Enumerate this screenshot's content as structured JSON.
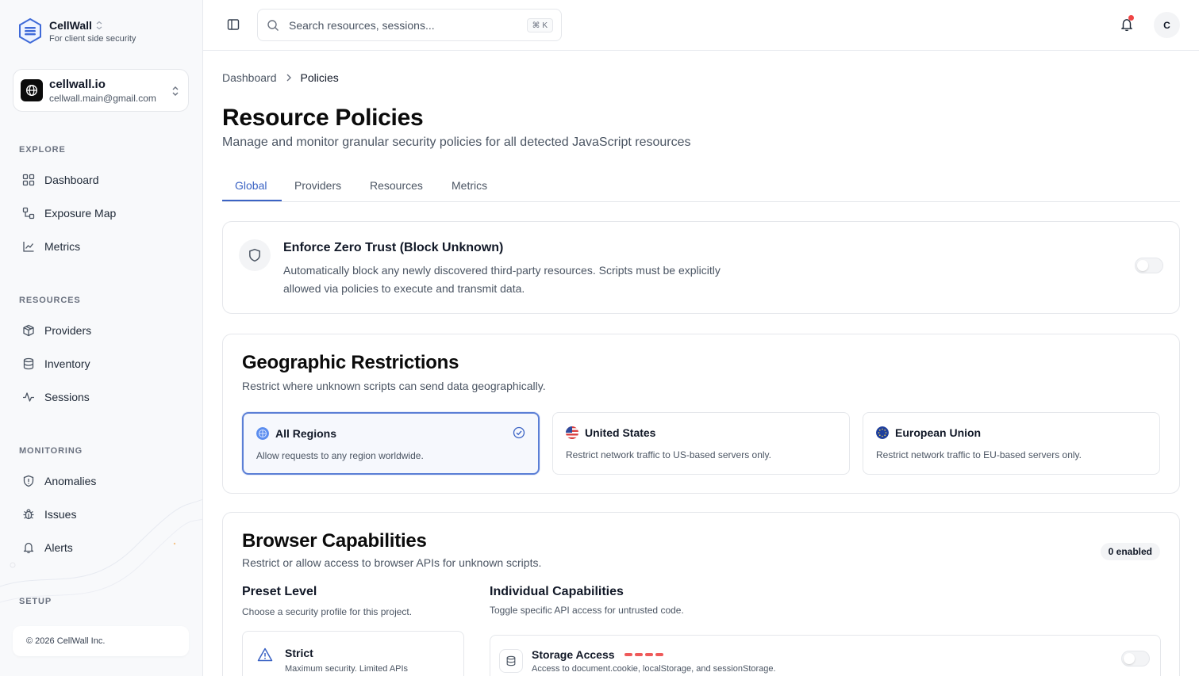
{
  "sidebar": {
    "brand_name": "CellWall",
    "brand_tagline": "For client side security",
    "site": {
      "name": "cellwall.io",
      "email": "cellwall.main@gmail.com"
    },
    "sections": {
      "explore": "EXPLORE",
      "resources": "RESOURCES",
      "monitoring": "MONITORING",
      "setup": "SETUP"
    },
    "items": [
      {
        "label": "Dashboard",
        "icon": "grid-icon"
      },
      {
        "label": "Exposure Map",
        "icon": "network-icon"
      },
      {
        "label": "Metrics",
        "icon": "line-chart-icon"
      },
      {
        "label": "Providers",
        "icon": "package-icon"
      },
      {
        "label": "Inventory",
        "icon": "database-icon"
      },
      {
        "label": "Sessions",
        "icon": "activity-icon"
      },
      {
        "label": "Anomalies",
        "icon": "shield-icon"
      },
      {
        "label": "Issues",
        "icon": "bug-icon"
      },
      {
        "label": "Alerts",
        "icon": "bell-icon"
      }
    ],
    "footer": "© 2026 CellWall Inc."
  },
  "topbar": {
    "search_placeholder": "Search resources, sessions...",
    "search_shortcut": "⌘ K",
    "avatar_initial": "C"
  },
  "main": {
    "breadcrumb": [
      "Dashboard",
      "Policies"
    ],
    "title": "Resource Policies",
    "subtitle": "Manage and monitor granular security policies for all detected JavaScript resources",
    "tabs": [
      "Global",
      "Providers",
      "Resources",
      "Metrics"
    ],
    "active_tab": "Global",
    "zero_trust": {
      "title": "Enforce Zero Trust (Block Unknown)",
      "description": "Automatically block any newly discovered third-party resources. Scripts must be explicitly allowed via policies to execute and transmit data.",
      "enabled": false
    },
    "geo": {
      "title": "Geographic Restrictions",
      "subtitle": "Restrict where unknown scripts can send data geographically.",
      "regions": [
        {
          "name": "All Regions",
          "description": "Allow requests to any region worldwide.",
          "selected": true
        },
        {
          "name": "United States",
          "description": "Restrict network traffic to US-based servers only.",
          "selected": false
        },
        {
          "name": "European Union",
          "description": "Restrict network traffic to EU-based servers only.",
          "selected": false
        }
      ]
    },
    "browser": {
      "title": "Browser Capabilities",
      "subtitle": "Restrict or allow access to browser APIs for unknown scripts.",
      "badge": "0 enabled",
      "preset": {
        "title": "Preset Level",
        "description": "Choose a security profile for this project.",
        "option_name": "Strict",
        "option_description": "Maximum security. Limited APIs"
      },
      "individual": {
        "title": "Individual Capabilities",
        "description": "Toggle specific API access for untrusted code.",
        "capability_name": "Storage Access",
        "capability_description": "Access to document.cookie, localStorage, and sessionStorage.",
        "enabled": false
      }
    }
  },
  "colors": {
    "accent": "#3b63c4",
    "risk": "#ef5a5a",
    "notification": "#ef4444"
  }
}
